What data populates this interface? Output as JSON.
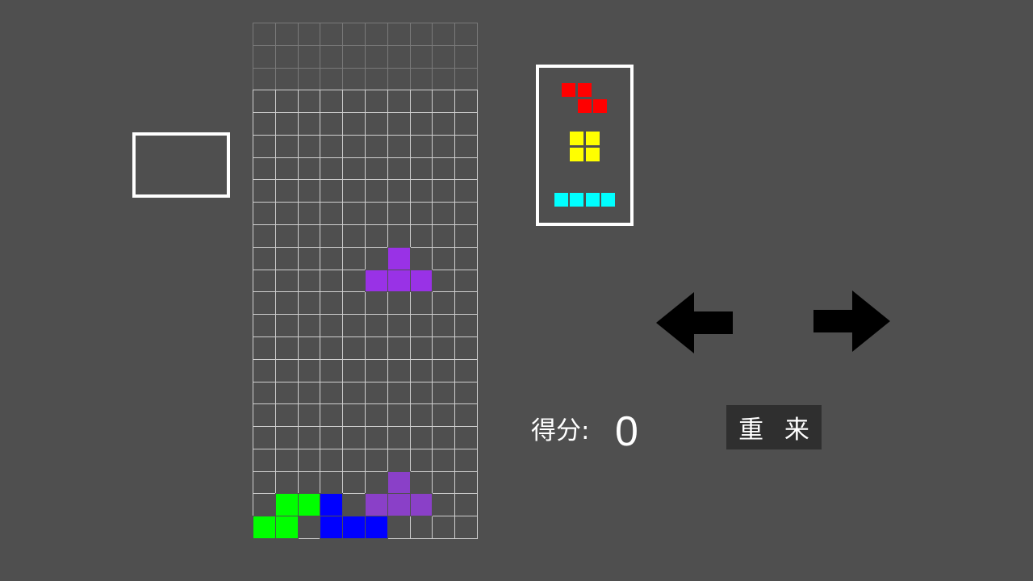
{
  "game": {
    "columns": 10,
    "rows": 23,
    "hidden_rows": 3,
    "score_label": "得分:",
    "score": "0",
    "restart_label": "重 来",
    "colors": {
      "background": "#4f4f4f",
      "grid_line": "#cfcfcf",
      "box_border": "#ffffff",
      "button_bg": "#2f2f2f",
      "arrow": "#000000"
    },
    "active_piece": {
      "name": "T",
      "color": "#9932e6",
      "cells": [
        [
          6,
          10
        ],
        [
          5,
          11
        ],
        [
          6,
          11
        ],
        [
          7,
          11
        ]
      ]
    },
    "ghost_piece": {
      "name": "T",
      "color": "#8a40c8",
      "cells": [
        [
          6,
          20
        ],
        [
          5,
          21
        ],
        [
          6,
          21
        ],
        [
          7,
          21
        ]
      ]
    },
    "locked_cells": [
      {
        "col": 1,
        "row": 21,
        "color": "#00ff00"
      },
      {
        "col": 2,
        "row": 21,
        "color": "#00ff00"
      },
      {
        "col": 0,
        "row": 22,
        "color": "#00ff00"
      },
      {
        "col": 1,
        "row": 22,
        "color": "#00ff00"
      },
      {
        "col": 3,
        "row": 21,
        "color": "#0000ff"
      },
      {
        "col": 3,
        "row": 22,
        "color": "#0000ff"
      },
      {
        "col": 4,
        "row": 22,
        "color": "#0000ff"
      },
      {
        "col": 5,
        "row": 22,
        "color": "#0000ff"
      }
    ],
    "hold_piece": null,
    "next_queue": [
      {
        "name": "Z",
        "color": "#ff0000",
        "cells": [
          [
            0,
            0
          ],
          [
            1,
            0
          ],
          [
            1,
            1
          ],
          [
            2,
            1
          ]
        ]
      },
      {
        "name": "O",
        "color": "#ffff00",
        "cells": [
          [
            0,
            0
          ],
          [
            1,
            0
          ],
          [
            0,
            1
          ],
          [
            1,
            1
          ]
        ]
      },
      {
        "name": "I",
        "color": "#00ffff",
        "cells": [
          [
            0,
            0
          ],
          [
            1,
            0
          ],
          [
            2,
            0
          ],
          [
            3,
            0
          ]
        ]
      }
    ],
    "icons": {
      "left": "arrow-left-icon",
      "right": "arrow-right-icon"
    }
  }
}
